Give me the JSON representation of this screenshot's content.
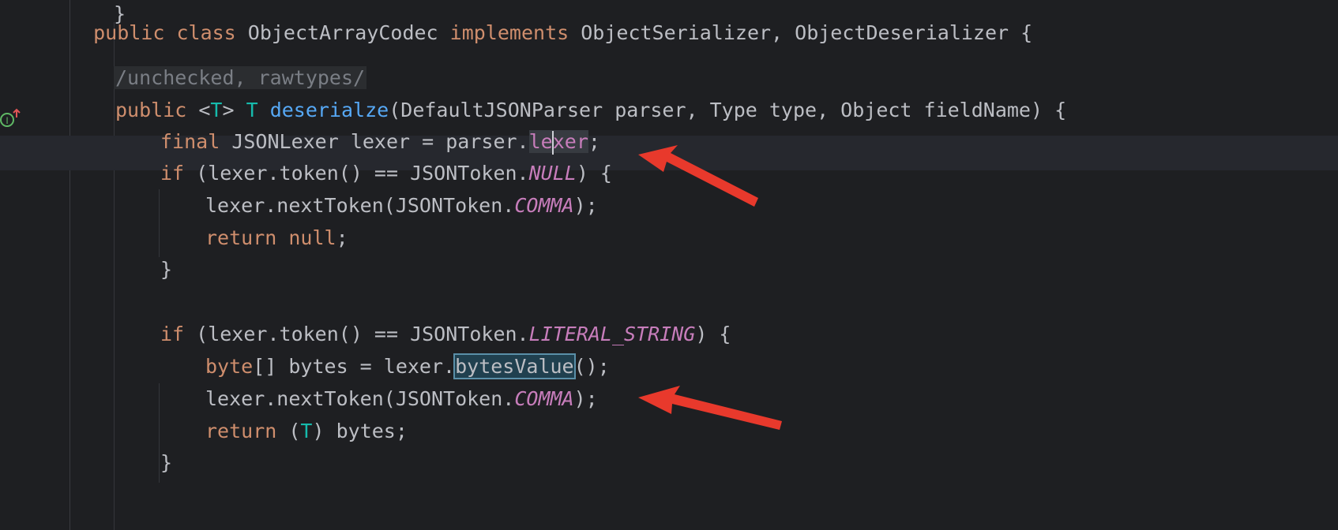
{
  "editor": {
    "lines": [
      {
        "id": "class-decl",
        "text": "public class ObjectArrayCodec implements ObjectSerializer, ObjectDeserializer {"
      },
      {
        "id": "closing-brace-top",
        "text": "}"
      },
      {
        "id": "annotation-comment",
        "text": "/unchecked, rawtypes/"
      },
      {
        "id": "method-sig",
        "parts": [
          "public ",
          "<",
          "T",
          "> ",
          "T ",
          "deserialze",
          "(DefaultJSONParser parser, Type type, Object fieldName) {"
        ]
      },
      {
        "id": "lexer-decl",
        "parts": [
          "final ",
          "JSONLexer lexer = parser.",
          "le",
          "x",
          "er",
          ";"
        ]
      },
      {
        "id": "if-null",
        "parts": [
          "if ",
          "(lexer.token() == JSONToken.",
          "NULL",
          ") {"
        ]
      },
      {
        "id": "next-token-1",
        "parts": [
          "lexer.nextToken(JSONToken.",
          "COMMA",
          ");"
        ]
      },
      {
        "id": "return-null",
        "parts": [
          "return ",
          "null",
          ";"
        ]
      },
      {
        "id": "close-if-1",
        "text": "}"
      },
      {
        "id": "if-literal",
        "parts": [
          "if ",
          "(lexer.token() == JSONToken.",
          "LITERAL_STRING",
          ") {"
        ]
      },
      {
        "id": "bytes-decl",
        "parts": [
          "byte",
          "[] bytes = lexer.",
          "bytesValue",
          "();"
        ]
      },
      {
        "id": "next-token-2",
        "parts": [
          "lexer.nextToken(JSONToken.",
          "COMMA",
          ");"
        ]
      },
      {
        "id": "return-bytes",
        "parts": [
          "return ",
          "(",
          "T",
          ") bytes;"
        ]
      },
      {
        "id": "close-if-2",
        "text": "}"
      }
    ]
  },
  "colors": {
    "background": "#1e1f22",
    "keyword": "#cf8e6d",
    "function": "#56a8f5",
    "constant": "#c77dbb",
    "type_param": "#16baac",
    "arrow": "#e8392c"
  },
  "icons": {
    "gutter": "implements-method-icon",
    "annotation": "red-arrow-annotation"
  }
}
